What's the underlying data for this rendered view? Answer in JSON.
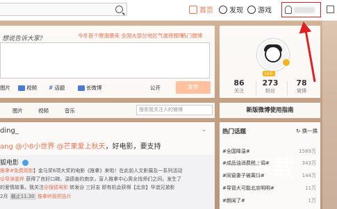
{
  "nav": {
    "home": "首页",
    "discover": "发现",
    "game": "游戏"
  },
  "post": {
    "question": "想说告诉大家?",
    "hot_tip": "今冬首个寒潮袭来 全国大部分地区气温将骤降",
    "hot_button": "热门微博",
    "tools": [
      "图片",
      "视频",
      "话题",
      "长微博"
    ],
    "visibility": "公开",
    "send": "发布"
  },
  "tabs": {
    "items": [
      "图片",
      "视频",
      "音乐"
    ],
    "search_placeholder": "搜索我关注人的微博"
  },
  "feed": {
    "name": "ding_",
    "line_prefix": "ang",
    "mention1": "@小8小世界",
    "mention2": "@芒果爱上秋天",
    "line_suffix": "，好电影，要支持",
    "quote": {
      "source": "狐电影",
      "lines": [
        {
          "a": "推拿#免费观影",
          "t": "】金马奖6项大奖的电影《推拿》来啦！在此前人文影展及一系列活动"
        },
        {
          "a": "@导演娄烨",
          "t": " 获得了良好口碑。温德善的南京，盲人推拿中心男女找师们之间，发生了"
        },
        {
          "a": "",
          "t": "的爱情故事。我关注"
        },
        {
          "a": "",
          "t": "2月"
        }
      ],
      "link1": "@搜狐电影",
      "link_tail": " 转发@ 三好友 即有机会获得【北京】华谊兄弟影",
      "badge": "截止11.30",
      "link2": "推拿终极预告片"
    }
  },
  "profile": {
    "level": "LV5",
    "stats": [
      {
        "n": "86",
        "l": "关注"
      },
      {
        "n": "273",
        "l": "粉丝"
      },
      {
        "n": "78",
        "l": "微博"
      }
    ]
  },
  "guide": "新版微博使用指南",
  "hot": {
    "title": "热门话题",
    "change": "换一换",
    "items": [
      {
        "t": "#全国降温#",
        "c": "1569万"
      },
      {
        "t": "#成品油消费税上调#",
        "c": "343万"
      },
      {
        "t": "#同窗妻子被离婚#",
        "c": "144万"
      },
      {
        "t": "#导冒大可能北京明明#",
        "c": "11万"
      },
      {
        "t": "#朗闻了#",
        "c": "1万"
      }
    ]
  },
  "watermark": "下载"
}
